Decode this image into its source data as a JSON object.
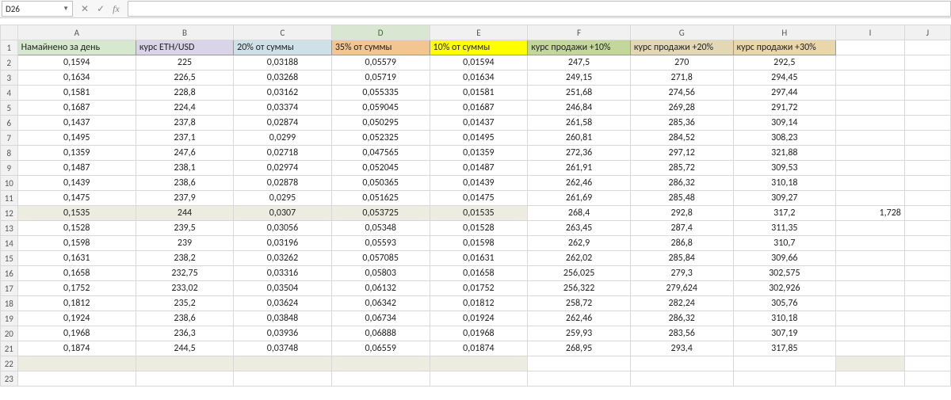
{
  "nameBox": "D26",
  "fxLabel": "fx",
  "formulaValue": "",
  "columns": [
    "A",
    "B",
    "C",
    "D",
    "E",
    "F",
    "G",
    "H",
    "I",
    "J"
  ],
  "selectedCol": "D",
  "headerRow": {
    "A": "Намайнено за день",
    "B": "курс ETH/USD",
    "C": "20% от суммы",
    "D": "35% от суммы",
    "E": "10% от суммы",
    "F": "курс продажи +10%",
    "G": "курс продажи +20%",
    "H": "курс продажи +30%"
  },
  "rows": [
    {
      "n": 2,
      "A": "0,1594",
      "B": "225",
      "C": "0,03188",
      "D": "0,05579",
      "E": "0,01594",
      "F": "247,5",
      "G": "270",
      "H": "292,5",
      "I": ""
    },
    {
      "n": 3,
      "A": "0,1634",
      "B": "226,5",
      "C": "0,03268",
      "D": "0,05719",
      "E": "0,01634",
      "F": "249,15",
      "G": "271,8",
      "H": "294,45",
      "I": ""
    },
    {
      "n": 4,
      "A": "0,1581",
      "B": "228,8",
      "C": "0,03162",
      "D": "0,055335",
      "E": "0,01581",
      "F": "251,68",
      "G": "274,56",
      "H": "297,44",
      "I": ""
    },
    {
      "n": 5,
      "A": "0,1687",
      "B": "224,4",
      "C": "0,03374",
      "D": "0,059045",
      "E": "0,01687",
      "F": "246,84",
      "G": "269,28",
      "H": "291,72",
      "I": ""
    },
    {
      "n": 6,
      "A": "0,1437",
      "B": "237,8",
      "C": "0,02874",
      "D": "0,050295",
      "E": "0,01437",
      "F": "261,58",
      "G": "285,36",
      "H": "309,14",
      "I": ""
    },
    {
      "n": 7,
      "A": "0,1495",
      "B": "237,1",
      "C": "0,0299",
      "D": "0,052325",
      "E": "0,01495",
      "F": "260,81",
      "G": "284,52",
      "H": "308,23",
      "I": ""
    },
    {
      "n": 8,
      "A": "0,1359",
      "B": "247,6",
      "C": "0,02718",
      "D": "0,047565",
      "E": "0,01359",
      "F": "272,36",
      "G": "297,12",
      "H": "321,88",
      "I": ""
    },
    {
      "n": 9,
      "A": "0,1487",
      "B": "238,1",
      "C": "0,02974",
      "D": "0,052045",
      "E": "0,01487",
      "F": "261,91",
      "G": "285,72",
      "H": "309,53",
      "I": ""
    },
    {
      "n": 10,
      "A": "0,1439",
      "B": "238,6",
      "C": "0,02878",
      "D": "0,050365",
      "E": "0,01439",
      "F": "262,46",
      "G": "286,32",
      "H": "310,18",
      "I": ""
    },
    {
      "n": 11,
      "A": "0,1475",
      "B": "237,9",
      "C": "0,0295",
      "D": "0,051625",
      "E": "0,01475",
      "F": "261,69",
      "G": "285,48",
      "H": "309,27",
      "I": ""
    },
    {
      "n": 12,
      "A": "0,1535",
      "B": "244",
      "C": "0,0307",
      "D": "0,053725",
      "E": "0,01535",
      "F": "268,4",
      "G": "292,8",
      "H": "317,2",
      "I": "1,728",
      "hl": true
    },
    {
      "n": 13,
      "A": "0,1528",
      "B": "239,5",
      "C": "0,03056",
      "D": "0,05348",
      "E": "0,01528",
      "F": "263,45",
      "G": "287,4",
      "H": "311,35",
      "I": ""
    },
    {
      "n": 14,
      "A": "0,1598",
      "B": "239",
      "C": "0,03196",
      "D": "0,05593",
      "E": "0,01598",
      "F": "262,9",
      "G": "286,8",
      "H": "310,7",
      "I": ""
    },
    {
      "n": 15,
      "A": "0,1631",
      "B": "238,2",
      "C": "0,03262",
      "D": "0,057085",
      "E": "0,01631",
      "F": "262,02",
      "G": "285,84",
      "H": "309,66",
      "I": ""
    },
    {
      "n": 16,
      "A": "0,1658",
      "B": "232,75",
      "C": "0,03316",
      "D": "0,05803",
      "E": "0,01658",
      "F": "256,025",
      "G": "279,3",
      "H": "302,575",
      "I": ""
    },
    {
      "n": 17,
      "A": "0,1752",
      "B": "233,02",
      "C": "0,03504",
      "D": "0,06132",
      "E": "0,01752",
      "F": "256,322",
      "G": "279,624",
      "H": "302,926",
      "I": ""
    },
    {
      "n": 18,
      "A": "0,1812",
      "B": "235,2",
      "C": "0,03624",
      "D": "0,06342",
      "E": "0,01812",
      "F": "258,72",
      "G": "282,24",
      "H": "305,76",
      "I": ""
    },
    {
      "n": 19,
      "A": "0,1924",
      "B": "238,6",
      "C": "0,03848",
      "D": "0,06734",
      "E": "0,01924",
      "F": "262,46",
      "G": "286,32",
      "H": "310,18",
      "I": ""
    },
    {
      "n": 20,
      "A": "0,1968",
      "B": "236,3",
      "C": "0,03936",
      "D": "0,06888",
      "E": "0,01968",
      "F": "259,93",
      "G": "283,56",
      "H": "307,19",
      "I": ""
    },
    {
      "n": 21,
      "A": "0,1874",
      "B": "244,5",
      "C": "0,03748",
      "D": "0,06559",
      "E": "0,01874",
      "F": "268,95",
      "G": "293,4",
      "H": "317,85",
      "I": ""
    },
    {
      "n": 22,
      "A": "",
      "B": "",
      "C": "",
      "D": "",
      "E": "",
      "F": "",
      "G": "",
      "H": "",
      "I": "",
      "hl": true
    },
    {
      "n": 23,
      "A": "",
      "B": "",
      "C": "",
      "D": "",
      "E": "",
      "F": "",
      "G": "",
      "H": "",
      "I": ""
    }
  ]
}
